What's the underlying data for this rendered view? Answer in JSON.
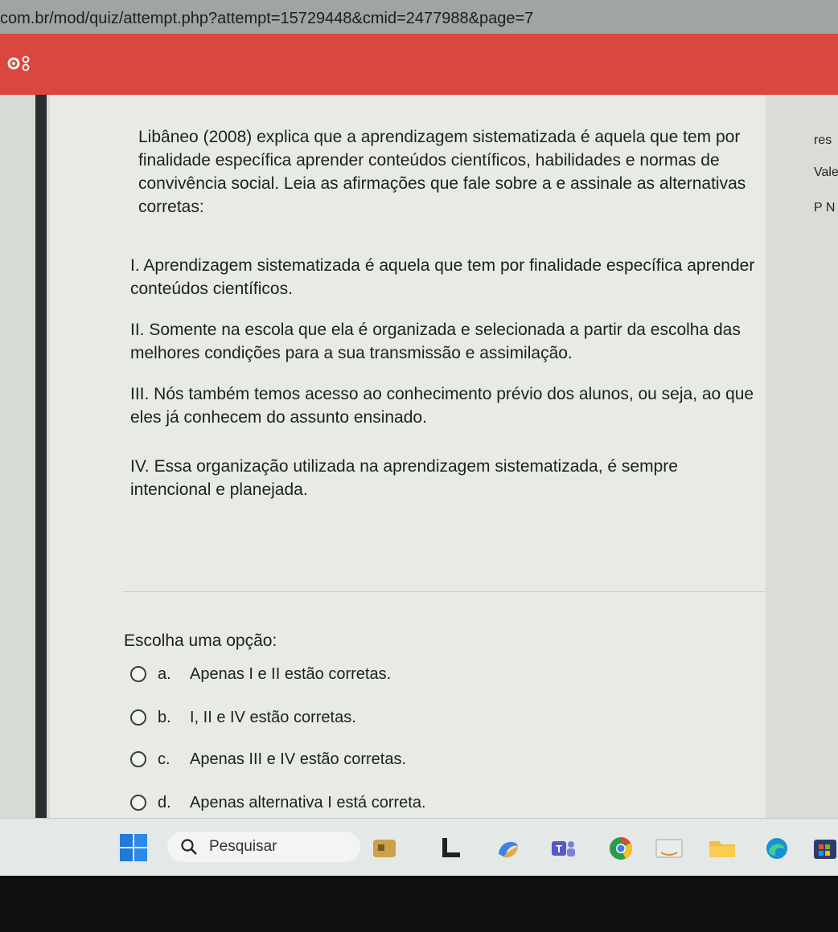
{
  "browser": {
    "url": "com.br/mod/quiz/attempt.php?attempt=15729448&cmid=2477988&page=7"
  },
  "header": {
    "gear_icon": "gear-icon"
  },
  "question": {
    "text": "Libâneo (2008) explica que a aprendizagem sistematizada é aquela que tem por finalidade específica aprender conteúdos científicos, habilidades e normas de convivência social. Leia as afirmações que fale sobre a  e assinale as alternativas corretas:",
    "statements": [
      "I. Aprendizagem sistematizada é aquela que tem por finalidade específica aprender conteúdos científicos.",
      "II. Somente na escola que ela é organizada e selecionada a partir da escolha das melhores condições para a sua transmissão e assimilação.",
      "III. Nós também temos acesso ao conhecimento prévio dos alunos, ou seja, ao que eles já conhecem do assunto ensinado.",
      "IV. Essa organização utilizada na aprendizagem sistematizada, é sempre intencional e planejada."
    ],
    "prompt": "Escolha uma opção:",
    "options": [
      {
        "letter": "a.",
        "text": "Apenas I e II estão corretas."
      },
      {
        "letter": "b.",
        "text": "I, II e IV estão corretas."
      },
      {
        "letter": "c.",
        "text": "Apenas III e IV estão corretas."
      },
      {
        "letter": "d.",
        "text": "Apenas alternativa I está correta."
      }
    ]
  },
  "sidebar_right": {
    "line1": "res",
    "line2": "Vale",
    "line3": "P N"
  },
  "taskbar": {
    "search_label": "Pesquisar",
    "icons": [
      "windows-start-icon",
      "search-icon",
      "widgets-icon",
      "file-icon",
      "copilot-icon",
      "teams-icon",
      "chrome-icon",
      "amazon-icon",
      "folder-icon",
      "edge-icon",
      "store-icon"
    ]
  }
}
